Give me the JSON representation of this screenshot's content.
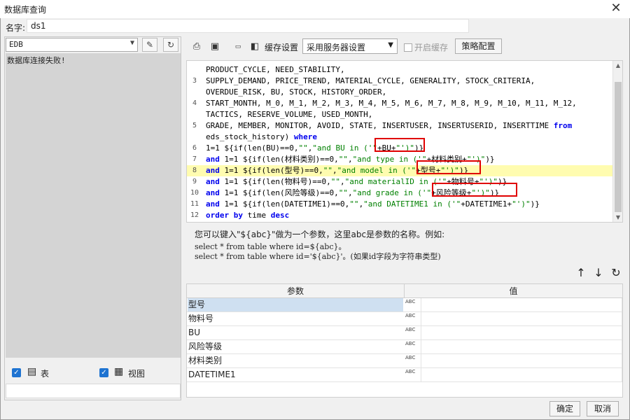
{
  "window": {
    "title": "数据库查询"
  },
  "name_field": {
    "label": "名字:",
    "value": "ds1"
  },
  "datasource": {
    "selected": "EDB",
    "status_message": "数据库连接失败!"
  },
  "left_options": {
    "table_label": "表",
    "view_label": "视图"
  },
  "toolbar": {
    "cache_label": "缓存设置",
    "cache_selected": "采用服务器设置",
    "enable_cache_label": "开启缓存",
    "policy_button": "策略配置"
  },
  "sql_lines": [
    {
      "n": "",
      "text": "PRODUCT_CYCLE, NEED_STABILITY,"
    },
    {
      "n": "3",
      "text": "SUPPLY_DEMAND, PRICE_TREND, MATERIAL_CYCLE, GENERALITY, STOCK_CRITERIA,"
    },
    {
      "n": "",
      "text": "OVERDUE_RISK, BU, STOCK, HISTORY_ORDER,"
    },
    {
      "n": "4",
      "text": "START_MONTH, M_0, M_1, M_2, M_3, M_4, M_5, M_6, M_7, M_8, M_9, M_10, M_11, M_12,"
    },
    {
      "n": "",
      "text": "TACTICS, RESERVE_VOLUME, USED_MONTH,"
    },
    {
      "n": "5",
      "text": "GRADE, MEMBER, MONITOR, AVOID, STATE, INSERTUSER, INSERTUSERID, INSERTTIME from"
    },
    {
      "n": "",
      "text": "eds_stock_history) where"
    },
    {
      "n": "6",
      "text": "1=1 ${if(len(BU)==0,\"\",\"and BU in ('\"+BU+\"')\")}"
    },
    {
      "n": "7",
      "text": "and 1=1 ${if(len(材料类别)==0,\"\",\"and type in ('\"+材料类别+\"')\")}"
    },
    {
      "n": "8",
      "text": "and 1=1 ${if(len(型号)==0,\"\",\"and model in ('\"+型号+\"')\")}"
    },
    {
      "n": "9",
      "text": "and 1=1 ${if(len(物料号)==0,\"\",\"and materialID in ('\"+物料号+\"')\")}"
    },
    {
      "n": "10",
      "text": "and 1=1 ${if(len(风险等级)==0,\"\",\"and grade in ('\"+风险等级+\"')\")}"
    },
    {
      "n": "11",
      "text": "and 1=1 ${if(len(DATETIME1)==0,\"\",\"and DATETIME1 in ('\"+DATETIME1+\"')\")}"
    },
    {
      "n": "12",
      "text": "order by time desc"
    }
  ],
  "help": {
    "line1": "您可以键入\"${abc}\"做为一个参数，这里abc是参数的名称。例如:",
    "line2": "select * from table where id=${abc}。",
    "line3": "select * from table where id='${abc}'。(如果id字段为字符串类型)"
  },
  "params_table": {
    "headers": {
      "name": "参数",
      "value": "值"
    },
    "type_icon_text": "ABC",
    "rows": [
      {
        "name": "型号",
        "value": ""
      },
      {
        "name": "物料号",
        "value": ""
      },
      {
        "name": "BU",
        "value": ""
      },
      {
        "name": "风险等级",
        "value": ""
      },
      {
        "name": "材料类别",
        "value": ""
      },
      {
        "name": "DATETIME1",
        "value": ""
      }
    ]
  },
  "footer": {
    "ok": "确定",
    "cancel": "取消"
  }
}
